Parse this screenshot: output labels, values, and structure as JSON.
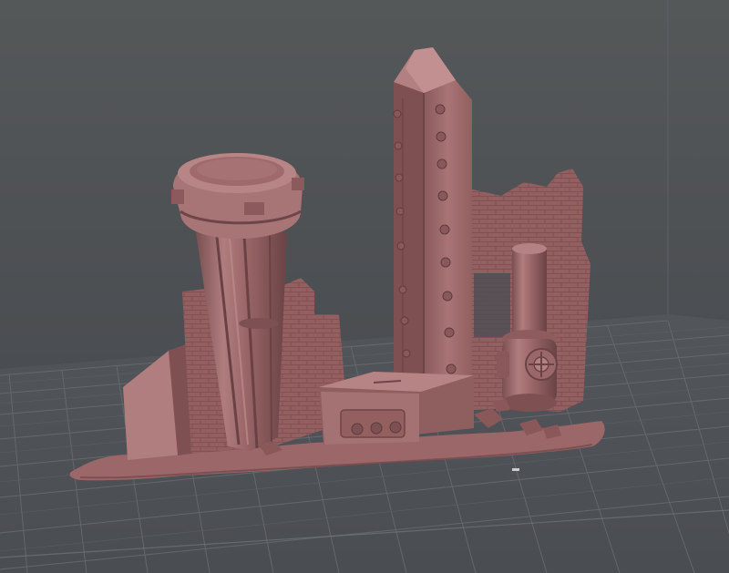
{
  "viewport": {
    "background_color": "#4a4d51",
    "model_color": "#a46e6f",
    "grid_color": "#6e7276"
  },
  "model": {
    "parts": [
      "water-tower",
      "spiked-pillar",
      "ruined-brick-wall",
      "pipe-valve",
      "control-panel",
      "rubble-base"
    ]
  }
}
